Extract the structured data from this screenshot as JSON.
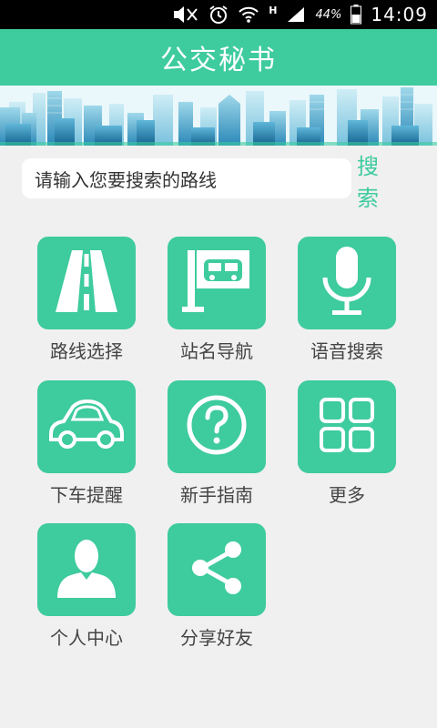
{
  "status_bar": {
    "network_type": "H",
    "battery": "44%",
    "time": "14:09",
    "icons": [
      "mute-icon",
      "alarm-icon",
      "wifi-icon",
      "signal-icon",
      "battery-icon"
    ]
  },
  "header": {
    "title": "公交秘书"
  },
  "search": {
    "placeholder": "请输入您要搜索的路线",
    "button_label": "搜 索"
  },
  "menu": [
    {
      "label": "路线选择",
      "icon": "road-icon"
    },
    {
      "label": "站名导航",
      "icon": "bus-stop-sign-icon"
    },
    {
      "label": "语音搜索",
      "icon": "microphone-icon"
    },
    {
      "label": "下车提醒",
      "icon": "car-icon"
    },
    {
      "label": "新手指南",
      "icon": "question-icon"
    },
    {
      "label": "更多",
      "icon": "grid-icon"
    },
    {
      "label": "个人中心",
      "icon": "person-icon"
    },
    {
      "label": "分享好友",
      "icon": "share-icon"
    }
  ],
  "colors": {
    "accent": "#3ecb9e",
    "background": "#f0f0f0"
  }
}
